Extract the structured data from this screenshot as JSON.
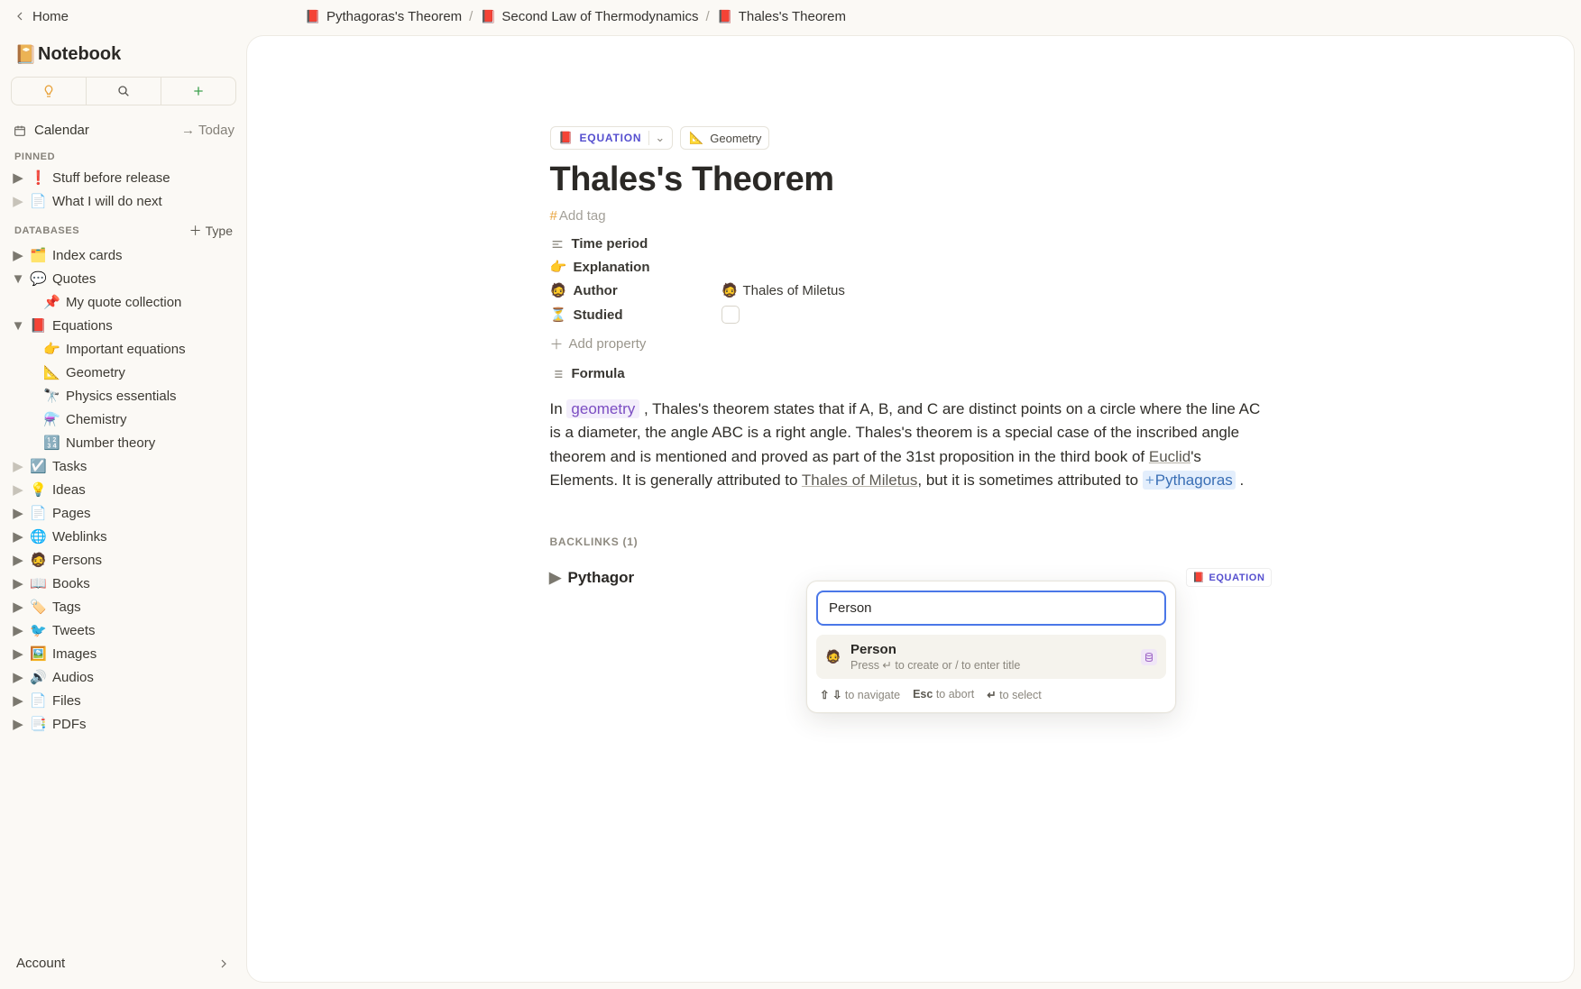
{
  "topbar": {
    "home": "Home",
    "crumbs": [
      {
        "icon": "📕",
        "label": "Pythagoras's Theorem"
      },
      {
        "icon": "📕",
        "label": "Second Law of Thermodynamics"
      },
      {
        "icon": "📕",
        "label": "Thales's Theorem"
      }
    ]
  },
  "sidebar": {
    "title": "Notebook",
    "title_icon": "📔",
    "calendar": "Calendar",
    "today": "Today",
    "pinned_head": "PINNED",
    "pinned": [
      {
        "icon": "❗",
        "label": "Stuff before release"
      },
      {
        "icon": "📄",
        "label": "What I will do next"
      }
    ],
    "db_head": "DATABASES",
    "type_btn": "Type",
    "databases": [
      {
        "tw": "▶",
        "icon": "🗂️",
        "label": "Index cards"
      },
      {
        "tw": "▼",
        "icon": "💬",
        "label": "Quotes",
        "children": [
          {
            "icon": "📌",
            "label": "My quote collection"
          }
        ]
      },
      {
        "tw": "▼",
        "icon": "📕",
        "label": "Equations",
        "children": [
          {
            "icon": "👉",
            "label": "Important equations"
          },
          {
            "icon": "📐",
            "label": "Geometry"
          },
          {
            "icon": "🔭",
            "label": "Physics essentials"
          },
          {
            "icon": "⚗️",
            "label": "Chemistry"
          },
          {
            "icon": "🔢",
            "label": "Number theory"
          }
        ]
      },
      {
        "tw": "▶",
        "icon": "☑️",
        "label": "Tasks",
        "muted": true
      },
      {
        "tw": "▶",
        "icon": "💡",
        "label": "Ideas",
        "muted": true
      },
      {
        "tw": "▶",
        "icon": "📄",
        "label": "Pages"
      },
      {
        "tw": "▶",
        "icon": "🌐",
        "label": "Weblinks"
      },
      {
        "tw": "▶",
        "icon": "🧔",
        "label": "Persons"
      },
      {
        "tw": "▶",
        "icon": "📖",
        "label": "Books"
      },
      {
        "tw": "▶",
        "icon": "🏷️",
        "label": "Tags"
      },
      {
        "tw": "▶",
        "icon": "🐦",
        "label": "Tweets"
      },
      {
        "tw": "▶",
        "icon": "🖼️",
        "label": "Images"
      },
      {
        "tw": "▶",
        "icon": "🔊",
        "label": "Audios"
      },
      {
        "tw": "▶",
        "icon": "📄",
        "label": "Files"
      },
      {
        "tw": "▶",
        "icon": "📑",
        "label": "PDFs"
      }
    ],
    "account": "Account"
  },
  "page": {
    "chip_eq_icon": "📕",
    "chip_eq": "EQUATION",
    "chip_geo_icon": "📐",
    "chip_geo": "Geometry",
    "title": "Thales's Theorem",
    "add_tag": "Add tag",
    "props": {
      "time_period": "Time period",
      "explanation_icon": "👉",
      "explanation": "Explanation",
      "author_icon": "🧔",
      "author": "Author",
      "author_value_icon": "🧔",
      "author_value": "Thales of Miletus",
      "studied_icon": "⏳",
      "studied": "Studied"
    },
    "add_property": "Add property",
    "formula_label": "Formula",
    "body": {
      "pre": "In ",
      "kw": "geometry",
      "mid1": " , Thales's theorem states that if A, B, and C are distinct points on a circle where the line AC is a diameter, the angle ABC is a right angle. Thales's theorem is a special case of the inscribed angle theorem and is mentioned and proved as part of the 31st proposition in the third book of ",
      "link1": "Euclid",
      "mid2": "'s Elements. It is generally attributed to ",
      "link2": "Thales of Miletus",
      "mid3": ", but it is sometimes attributed to ",
      "mention": "Pythagoras",
      "end": " ."
    },
    "backlinks_head": "BACKLINKS (1)",
    "backlink_item": "Pythagor",
    "backlink_tag_icon": "📕",
    "backlink_tag": "EQUATION"
  },
  "popup": {
    "input_value": "Person",
    "sugg_icon": "🧔",
    "sugg_title": "Person",
    "sugg_sub": "Press ↵ to create or / to enter title",
    "hint_nav": "to navigate",
    "hint_nav_key": "⇧ ⇩",
    "hint_esc_key": "Esc",
    "hint_esc": "to abort",
    "hint_sel_key": "↵",
    "hint_sel": "to select"
  }
}
